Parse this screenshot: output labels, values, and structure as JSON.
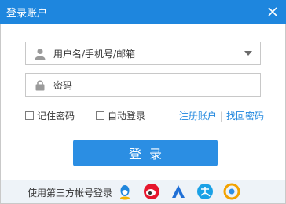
{
  "window": {
    "title": "登录账户",
    "close_label": "✕"
  },
  "username": {
    "placeholder": "用户名/手机号/邮箱",
    "icon": "user-icon",
    "dropdown_icon": "chevron-down-icon"
  },
  "password": {
    "placeholder": "密码",
    "icon": "lock-icon"
  },
  "options": {
    "remember": {
      "label": "记住密码",
      "checked": false
    },
    "autologin": {
      "label": "自动登录",
      "checked": false
    },
    "register_link": "注册账户",
    "separator": "|",
    "forgot_link": "找回密码"
  },
  "login_button": "登录",
  "third_party": {
    "label": "使用第三方帐号登录",
    "providers": [
      "qq-icon",
      "weibo-icon",
      "baidu-icon",
      "alipay-icon",
      "tencent-weibo-icon"
    ]
  },
  "colors": {
    "title_bar": "#1e86de",
    "button": "#2b8ee3",
    "link": "#1e86de",
    "footer": "#eef3f8"
  }
}
